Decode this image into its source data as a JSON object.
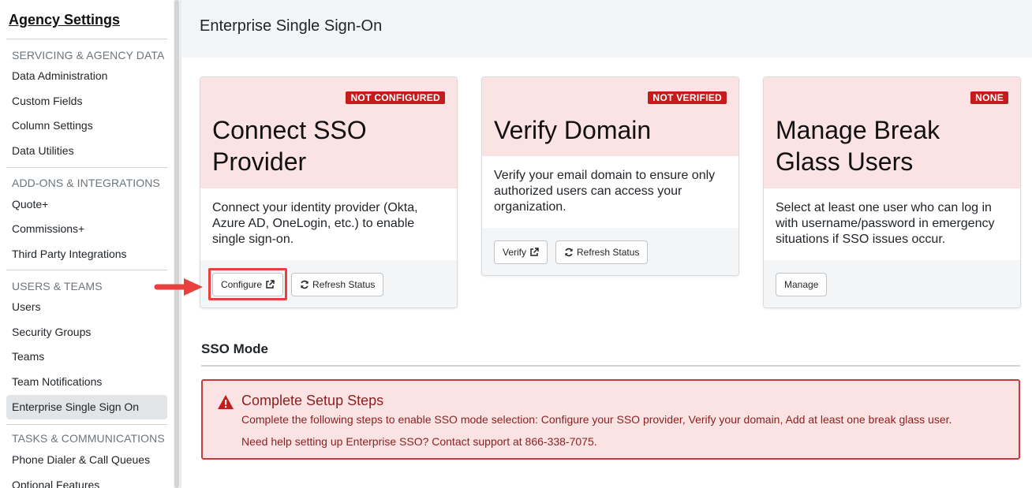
{
  "sidebar": {
    "title": "Agency Settings",
    "sections": [
      {
        "label": "SERVICING & AGENCY DATA",
        "items": [
          "Data Administration",
          "Custom Fields",
          "Column Settings",
          "Data Utilities"
        ]
      },
      {
        "label": "ADD-ONS & INTEGRATIONS",
        "items": [
          "Quote+",
          "Commissions+",
          "Third Party Integrations"
        ]
      },
      {
        "label": "USERS & TEAMS",
        "items": [
          "Users",
          "Security Groups",
          "Teams",
          "Team Notifications",
          "Enterprise Single Sign On"
        ]
      },
      {
        "label": "TASKS & COMMUNICATIONS",
        "items": [
          "Phone Dialer & Call Queues",
          "Optional Features"
        ]
      }
    ],
    "active_item": "Enterprise Single Sign On"
  },
  "page": {
    "title": "Enterprise Single Sign-On"
  },
  "cards": [
    {
      "badge": "NOT CONFIGURED",
      "title": "Connect SSO Provider",
      "body": "Connect your identity provider (Okta, Azure AD, OneLogin, etc.) to enable single sign-on.",
      "primary_label": "Configure",
      "secondary_label": "Refresh Status"
    },
    {
      "badge": "NOT VERIFIED",
      "title": "Verify Domain",
      "body": "Verify your email domain to ensure only authorized users can access your organization.",
      "primary_label": "Verify",
      "secondary_label": "Refresh Status"
    },
    {
      "badge": "NONE",
      "title": "Manage Break Glass Users",
      "body": "Select at least one user who can log in with username/password in emergency situations if SSO issues occur.",
      "primary_label": "Manage"
    }
  ],
  "sso_mode": {
    "title": "SSO Mode",
    "alert": {
      "title": "Complete Setup Steps",
      "line1": "Complete the following steps to enable SSO mode selection: Configure your SSO provider, Verify your domain, Add at least one break glass user.",
      "line2": "Need help setting up Enterprise SSO? Contact support at 866-338-7075."
    }
  },
  "colors": {
    "badge": "#c41c1c",
    "card_header": "#fbe3e4",
    "alert_border": "#c63b3b",
    "highlight": "#e8403c"
  },
  "icons": [
    "external-link-icon",
    "refresh-icon",
    "warning-icon",
    "arrow-icon"
  ]
}
